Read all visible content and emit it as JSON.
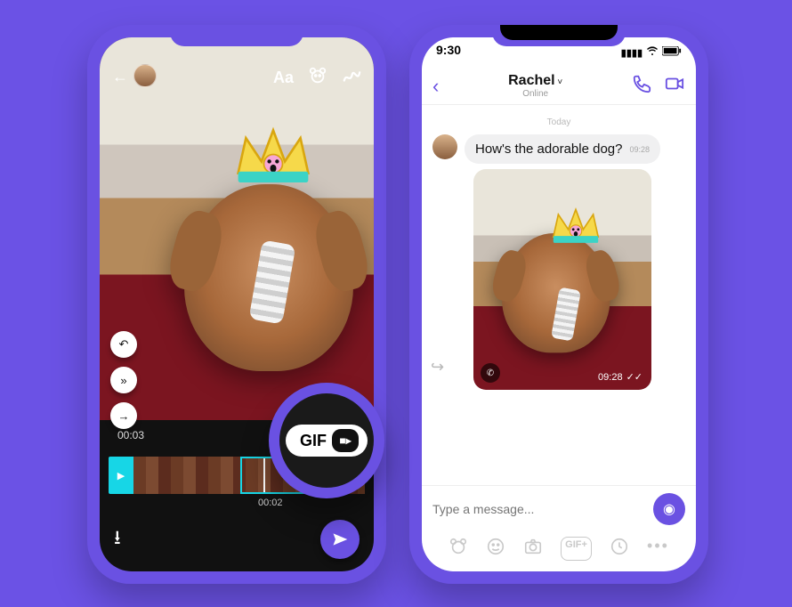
{
  "colors": {
    "brand": "#6a51e2",
    "cyan": "#17d6e6"
  },
  "left_phone": {
    "top": {
      "text_label": "Aa",
      "sticker_icon": "bear-icon",
      "draw_icon": "scribble-icon",
      "back_icon": "back-arrow-icon"
    },
    "side_buttons": {
      "undo_icon": "undo-icon",
      "skip_icon": "skip-forward-icon",
      "next_icon": "next-arrow-icon"
    },
    "time_total": "00:03",
    "time_clip": "00:02",
    "gif_toggle": {
      "label": "GIF",
      "alt_icon": "video-camera-icon"
    },
    "bottom": {
      "download_icon": "download-icon",
      "send_icon": "send-icon"
    }
  },
  "right_phone": {
    "status": {
      "time": "9:30",
      "signal_icon": "cellular-signal-icon",
      "wifi_icon": "wifi-icon",
      "battery_icon": "battery-icon"
    },
    "header": {
      "back_icon": "chevron-left-icon",
      "name": "Rachel",
      "chevron_icon": "chevron-down-icon",
      "subtitle": "Online",
      "call_icon": "phone-icon",
      "video_icon": "video-camera-icon"
    },
    "chat": {
      "day_label": "Today",
      "message_text": "How's the adorable dog?",
      "message_time": "09:28",
      "image_time": "09:28",
      "read_icon": "double-check-icon",
      "viber_icon": "viber-badge-icon",
      "forward_icon": "share-arrow-icon"
    },
    "composer": {
      "placeholder": "Type a message...",
      "mic_icon": "voice-message-icon"
    },
    "toolbar": {
      "sticker_icon": "bear-outline-icon",
      "emoji_icon": "smiley-outline-icon",
      "camera_icon": "camera-outline-icon",
      "gif_label": "GIF+",
      "recent_icon": "clock-icon",
      "more_icon": "more-dots-icon"
    }
  },
  "magnifier": {
    "label": "GIF"
  }
}
